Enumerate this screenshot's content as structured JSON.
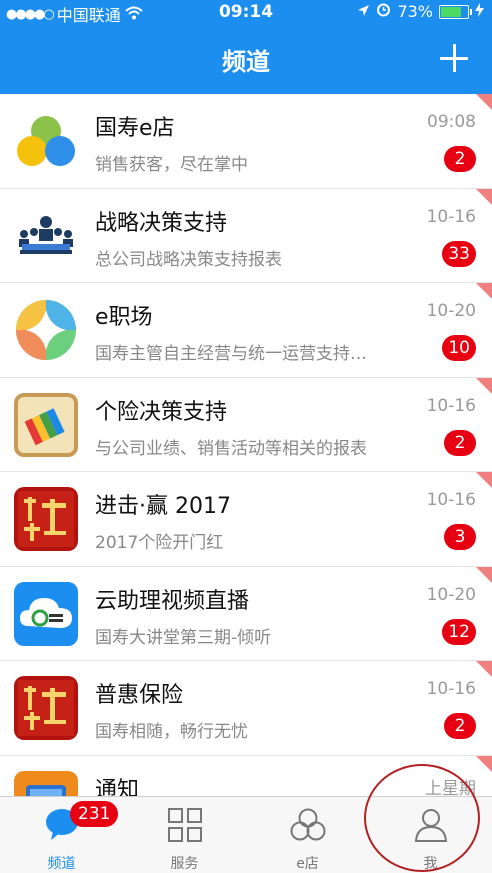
{
  "status_bar": {
    "carrier": "中国联通",
    "time": "09:14",
    "battery": "73%",
    "battery_level": 0.73
  },
  "header": {
    "title": "频道"
  },
  "channels": [
    {
      "title": "国寿e店",
      "subtitle": "销售获客，尽在掌中",
      "time": "09:08",
      "badge": "2",
      "icon": "cloud-three-circles-icon"
    },
    {
      "title": "战略决策支持",
      "subtitle": "总公司战略决策支持报表",
      "time": "10-16",
      "badge": "33",
      "icon": "meeting-people-icon"
    },
    {
      "title": "e职场",
      "subtitle": "国寿主管自主经营与统一运营支持…",
      "time": "10-20",
      "badge": "10",
      "icon": "rainbow-ring-icon"
    },
    {
      "title": "个险决策支持",
      "subtitle": "与公司业绩、销售活动等相关的报表",
      "time": "10-16",
      "badge": "2",
      "icon": "colored-book-icon"
    },
    {
      "title": "进击·赢 2017",
      "subtitle": "2017个险开门红",
      "time": "10-16",
      "badge": "3",
      "icon": "red-calligraphy-icon"
    },
    {
      "title": "云助理视频直播",
      "subtitle": "国寿大讲堂第三期-倾听",
      "time": "10-20",
      "badge": "12",
      "icon": "cloud-live-icon"
    },
    {
      "title": "普惠保险",
      "subtitle": "国寿相随，畅行无忧",
      "time": "10-16",
      "badge": "2",
      "icon": "red-calligraphy-icon"
    },
    {
      "title": "通知",
      "subtitle": "",
      "time": "上星期",
      "badge": "",
      "icon": "notice-tablet-icon"
    }
  ],
  "tabbar": {
    "tabs": [
      {
        "label": "频道",
        "icon": "chat-bubble-icon",
        "active": true
      },
      {
        "label": "服务",
        "icon": "grid-icon",
        "active": false
      },
      {
        "label": "e店",
        "icon": "three-circles-icon",
        "active": false
      },
      {
        "label": "我",
        "icon": "person-icon",
        "active": false
      }
    ],
    "channel_badge": "231"
  },
  "colors": {
    "accent": "#1c8ef0",
    "badge": "#e60012",
    "annotation": "#b22222"
  }
}
